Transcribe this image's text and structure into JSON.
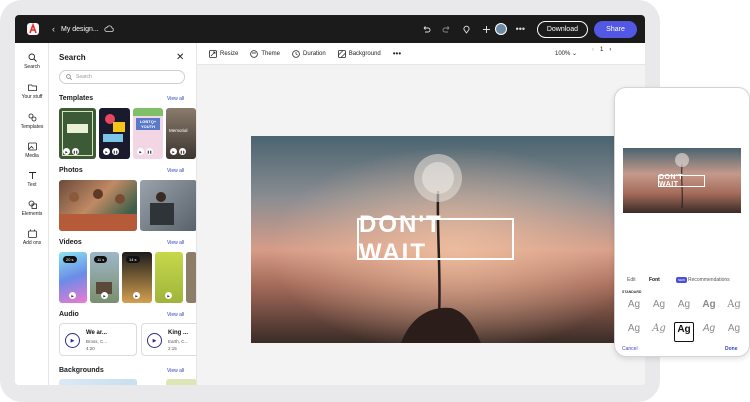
{
  "topbar": {
    "doc_name": "My design...",
    "download_label": "Download",
    "share_label": "Share",
    "accent": "#5258e4"
  },
  "rail": {
    "items": [
      {
        "label": "Search",
        "icon": "search-icon"
      },
      {
        "label": "Your stuff",
        "icon": "folder-icon"
      },
      {
        "label": "Templates",
        "icon": "templates-icon"
      },
      {
        "label": "Media",
        "icon": "media-icon"
      },
      {
        "label": "Text",
        "icon": "text-icon"
      },
      {
        "label": "Elements",
        "icon": "elements-icon"
      },
      {
        "label": "Add ons",
        "icon": "add-ons-icon"
      }
    ]
  },
  "panel": {
    "title": "Search",
    "search_placeholder": "Search",
    "sections": {
      "templates": {
        "title": "Templates",
        "view_all": "View all"
      },
      "photos": {
        "title": "Photos",
        "view_all": "View all"
      },
      "videos": {
        "title": "Videos",
        "view_all": "View all",
        "durations": [
          "20 s",
          "11 s",
          "14 s"
        ]
      },
      "audio": {
        "title": "Audio",
        "view_all": "View all"
      },
      "backgrounds": {
        "title": "Backgrounds",
        "view_all": "View all"
      }
    },
    "template_texts": [
      "LGBTQ+ YOUTH",
      "Memorial"
    ],
    "audio_items": [
      {
        "title": "We ar...",
        "artist": "Bross, C...",
        "length": "4:20"
      },
      {
        "title": "King ...",
        "artist": "Earth, C...",
        "length": "2:15"
      }
    ]
  },
  "toolbar": {
    "items": [
      "Resize",
      "Theme",
      "Duration",
      "Background"
    ],
    "zoom": "100%",
    "page": "1"
  },
  "canvas": {
    "headline": "DON'T WAIT"
  },
  "phone": {
    "headline": "DON'T WAIT",
    "tabs": {
      "edit": "Edit",
      "font": "Font",
      "new_badge": "NEW",
      "recommendations": "Recommendations"
    },
    "standard_label": "STANDARD",
    "font_sample": "Ag",
    "cancel": "Cancel",
    "done": "Done"
  }
}
